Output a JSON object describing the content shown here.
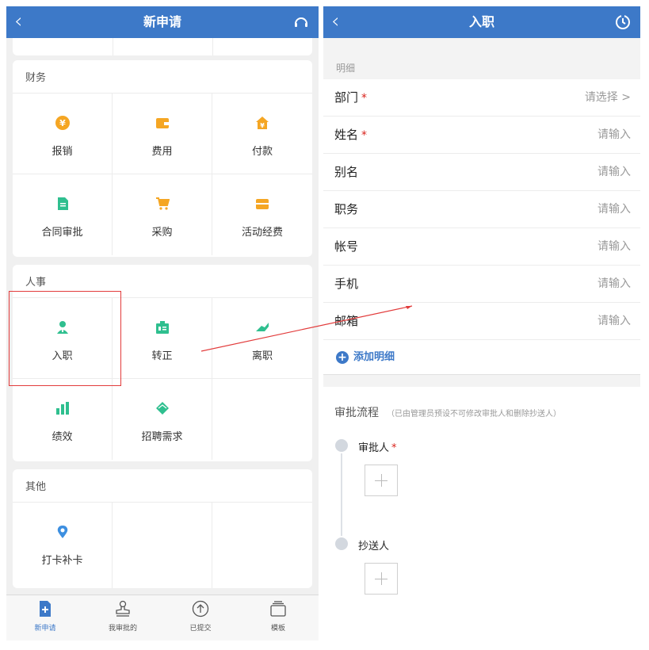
{
  "left": {
    "header": {
      "title": "新申请",
      "back_icon": "chevron-left-icon",
      "action_icon": "headset-icon"
    },
    "sections": [
      {
        "title": "财务",
        "items": [
          {
            "label": "报销",
            "icon": "yen-coin-icon",
            "color": "#f5a623"
          },
          {
            "label": "费用",
            "icon": "wallet-icon",
            "color": "#f5a623"
          },
          {
            "label": "付款",
            "icon": "house-yen-icon",
            "color": "#f5a623"
          },
          {
            "label": "合同审批",
            "icon": "document-icon",
            "color": "#2fbf8f"
          },
          {
            "label": "采购",
            "icon": "cart-icon",
            "color": "#f5a623"
          },
          {
            "label": "活动经费",
            "icon": "box-icon",
            "color": "#f5a623"
          }
        ]
      },
      {
        "title": "人事",
        "items": [
          {
            "label": "入职",
            "icon": "person-icon",
            "color": "#2fbf8f"
          },
          {
            "label": "转正",
            "icon": "id-badge-icon",
            "color": "#2fbf8f"
          },
          {
            "label": "离职",
            "icon": "handshake-leave-icon",
            "color": "#2fbf8f"
          },
          {
            "label": "绩效",
            "icon": "bar-chart-icon",
            "color": "#2fbf8f"
          },
          {
            "label": "招聘需求",
            "icon": "handshake-icon",
            "color": "#2fbf8f"
          }
        ]
      },
      {
        "title": "其他",
        "items": [
          {
            "label": "打卡补卡",
            "icon": "location-pin-icon",
            "color": "#3d8fe0"
          }
        ]
      }
    ],
    "tabs": [
      {
        "label": "新申请",
        "icon": "new-doc-icon",
        "active": true
      },
      {
        "label": "我审批的",
        "icon": "stamp-icon",
        "active": false
      },
      {
        "label": "已提交",
        "icon": "upload-circle-icon",
        "active": false
      },
      {
        "label": "模板",
        "icon": "template-stack-icon",
        "active": false
      }
    ]
  },
  "right": {
    "header": {
      "title": "入职",
      "back_icon": "chevron-left-icon",
      "action_icon": "history-clock-icon"
    },
    "detail_label": "明细",
    "fields": [
      {
        "label": "部门",
        "required": "*",
        "value": "请选择 >"
      },
      {
        "label": "姓名",
        "required": "*",
        "value": "请输入"
      },
      {
        "label": "别名",
        "required": "",
        "value": "请输入"
      },
      {
        "label": "职务",
        "required": "",
        "value": "请输入"
      },
      {
        "label": "帐号",
        "required": "",
        "value": "请输入"
      },
      {
        "label": "手机",
        "required": "",
        "value": "请输入"
      },
      {
        "label": "邮箱",
        "required": "",
        "value": "请输入"
      }
    ],
    "add_detail": "添加明细",
    "flow": {
      "title": "审批流程",
      "note": "（已由管理员预设不可修改审批人和删除抄送人）",
      "approver": "审批人",
      "approver_required": "*",
      "cc": "抄送人"
    }
  },
  "colors": {
    "brand": "#3d79c8",
    "required": "#d9231c",
    "annotation": "#e23b3b"
  }
}
